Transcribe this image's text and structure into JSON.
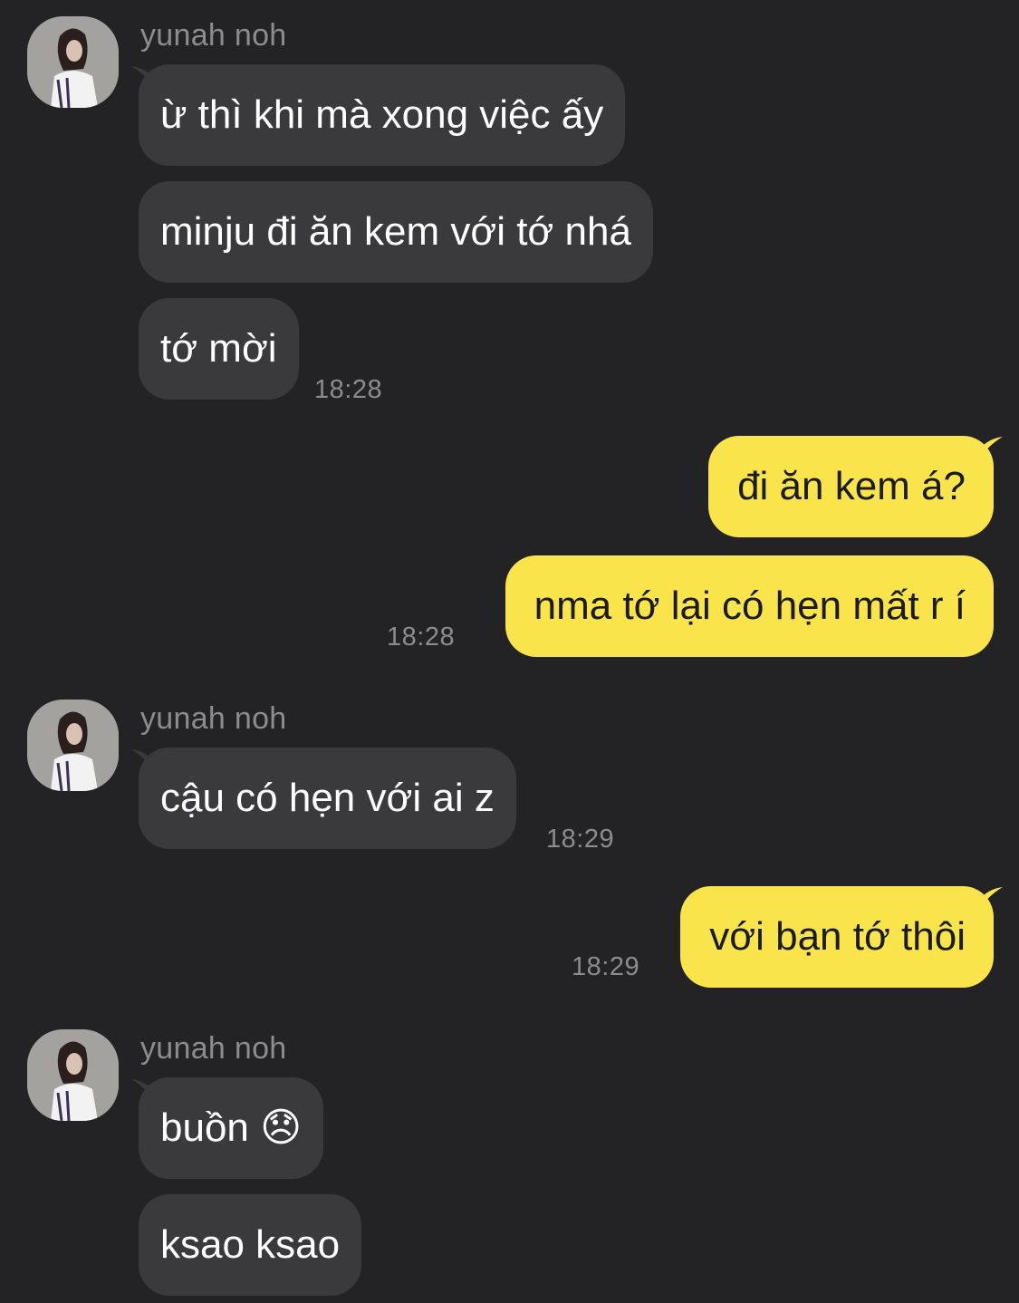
{
  "colors": {
    "background": "#232325",
    "incoming_bubble": "#3a3a3c",
    "outgoing_bubble": "#f9e54b",
    "meta_text": "#8c8c8f"
  },
  "conversation": [
    {
      "sender": "yunah noh",
      "messages": [
        "ừ thì khi mà xong việc ấy",
        "minju đi ăn kem với tớ nhá",
        "tớ mời"
      ],
      "time": "18:28"
    },
    {
      "sender": "me",
      "messages": [
        "đi ăn kem á?",
        "nma tớ lại có hẹn mất r í"
      ],
      "time": "18:28"
    },
    {
      "sender": "yunah noh",
      "messages": [
        "cậu có hẹn với ai z"
      ],
      "time": "18:29"
    },
    {
      "sender": "me",
      "messages": [
        "với bạn tớ thôi"
      ],
      "time": "18:29"
    },
    {
      "sender": "yunah noh",
      "messages": [
        "buồn 😞",
        "ksao ksao"
      ]
    }
  ],
  "avatar_icon": "profile-photo"
}
